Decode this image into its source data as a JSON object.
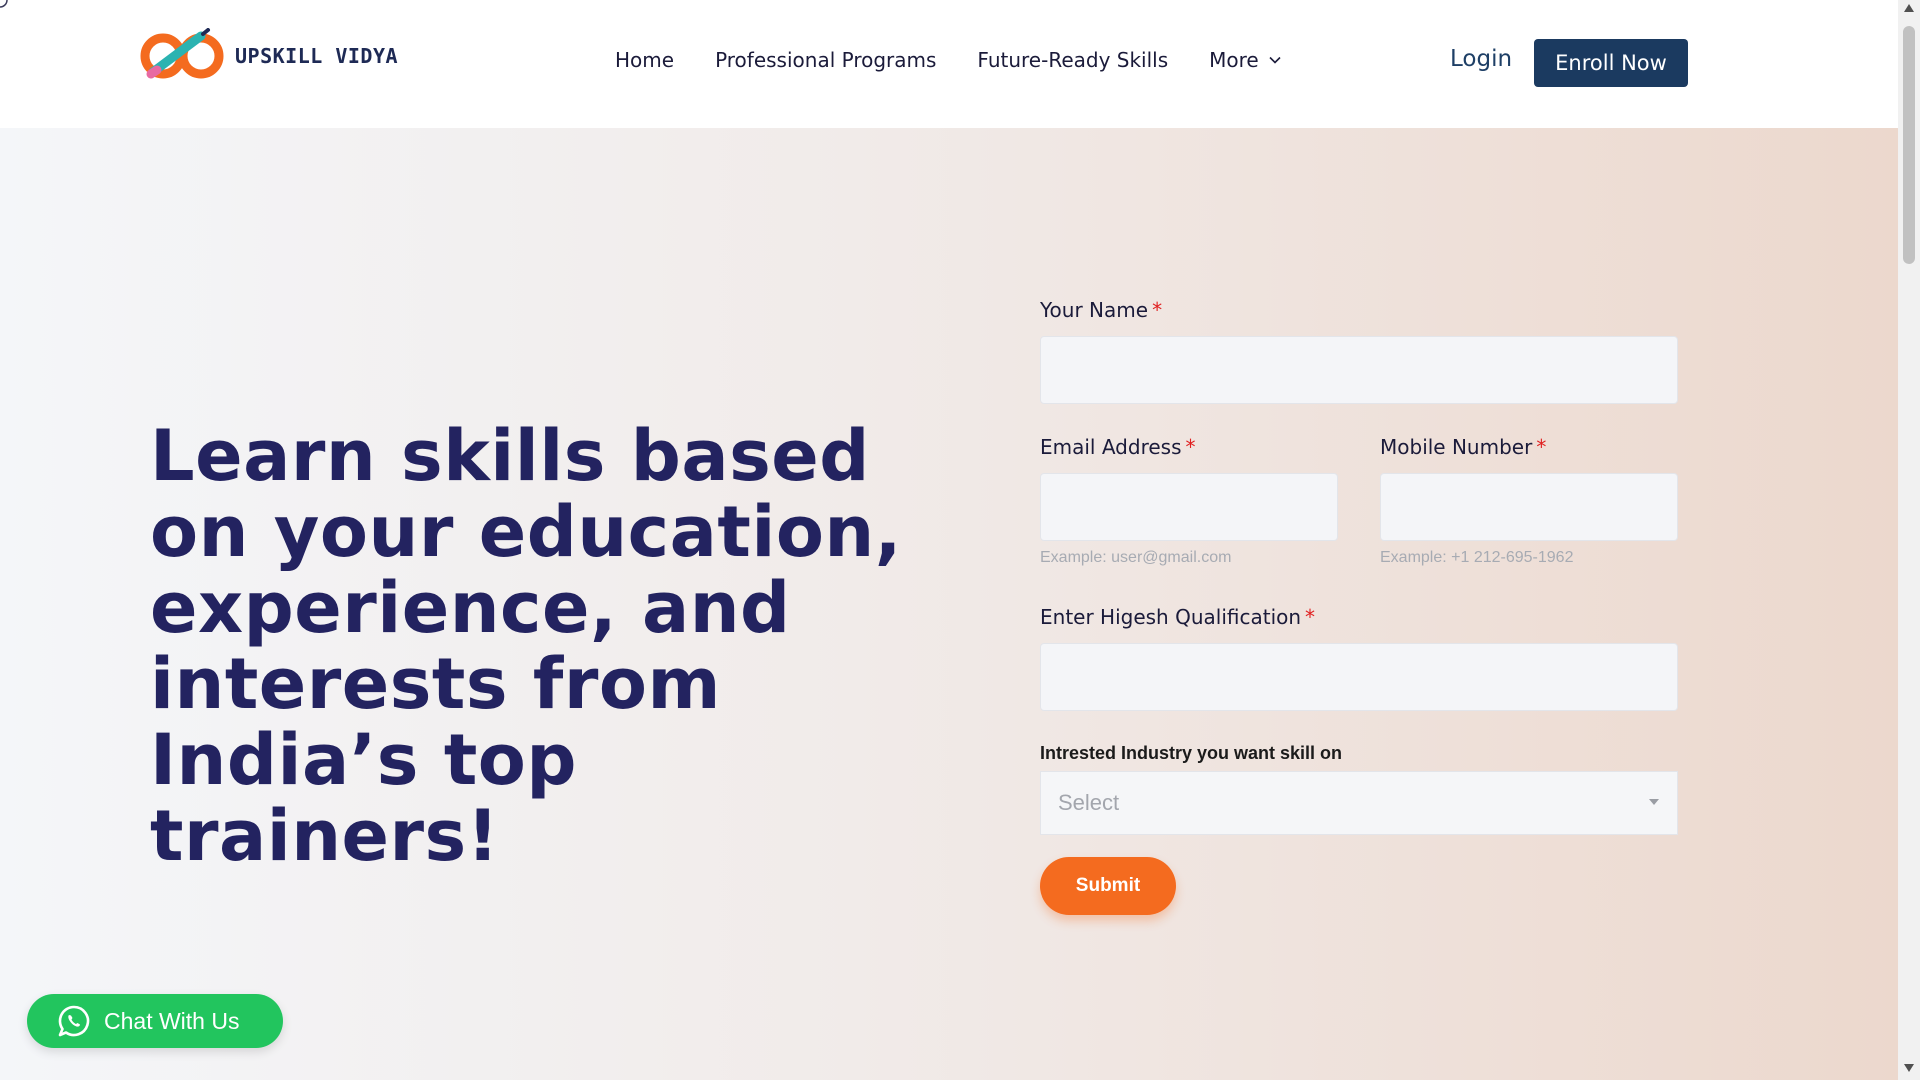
{
  "header": {
    "logo_text": "UPSKILL VIDYA",
    "nav": {
      "home": "Home",
      "professional_programs": "Professional Programs",
      "future_ready_skills": "Future-Ready Skills",
      "more": "More"
    },
    "login": "Login",
    "enroll": "Enroll Now"
  },
  "hero": {
    "headline": "Learn skills based on your education, experience, and interests from India’s top trainers!"
  },
  "form": {
    "required_mark": "*",
    "name_label": "Your Name",
    "name_value": "",
    "email_label": "Email Address",
    "email_value": "",
    "email_helper": "Example: user@gmail.com",
    "mobile_label": "Mobile Number",
    "mobile_value": "",
    "mobile_helper": "Example: +1 212-695-1962",
    "qualification_label": "Enter Higesh Qualification",
    "qualification_value": "",
    "industry_label": "Intrested Industry you want skill on",
    "industry_selected": "Select",
    "submit": "Submit"
  },
  "chat": {
    "label": "Chat With Us"
  },
  "colors": {
    "brand_navy": "#1b3a60",
    "headline": "#232360",
    "submit_orange": "#f46b1f",
    "chat_green": "#22c55e",
    "required_red": "#e02020"
  },
  "icons": [
    "logo-infinity-icon",
    "chevron-down-icon",
    "whatsapp-icon",
    "select-caret-icon",
    "scroll-up-icon",
    "scroll-down-icon"
  ]
}
